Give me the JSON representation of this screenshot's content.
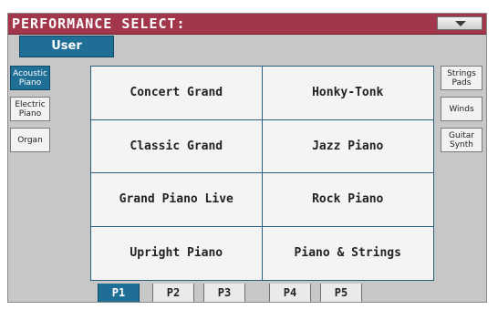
{
  "header": {
    "title": "PERFORMANCE SELECT:",
    "menu_icon": "dropdown-triangle-icon"
  },
  "bank_tab": {
    "label": "User"
  },
  "left_categories": [
    {
      "label": "Acoustic\nPiano",
      "active": true
    },
    {
      "label": "Electric\nPiano",
      "active": false
    },
    {
      "label": "Organ",
      "active": false
    }
  ],
  "right_categories": [
    {
      "label": "Strings\nPads"
    },
    {
      "label": "Winds"
    },
    {
      "label": "Guitar\nSynth"
    }
  ],
  "performances": [
    "Concert Grand",
    "Honky-Tonk",
    "Classic Grand",
    "Jazz Piano",
    "Grand Piano Live",
    "Rock Piano",
    "Upright Piano",
    "Piano & Strings"
  ],
  "pages": [
    "P1",
    "P2",
    "P3",
    "P4",
    "P5"
  ],
  "colors": {
    "title_bar": "#a2364b",
    "accent_blue": "#1f6e96",
    "panel_gray": "#c7c7c7"
  }
}
